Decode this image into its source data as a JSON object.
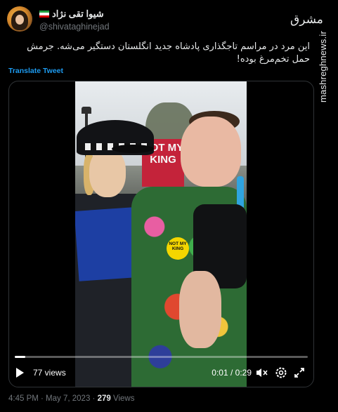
{
  "author": {
    "display_name": "شیوا تقی نژاد",
    "handle": "@shivataghinejad",
    "flag_colors": [
      "#239f40",
      "#ffffff",
      "#da0000"
    ]
  },
  "watermark": {
    "logo_text": "مشرق",
    "url_text": "mashreghnews.ir"
  },
  "tweet": {
    "text": "این مرد در مراسم تاجگذاری پادشاه جدید انگلستان دستگیر می‌شه. جرمش حمل تخم‌مرغ بوده!",
    "translate_label": "Translate Tweet"
  },
  "video": {
    "views_label": "77 views",
    "time_label": "0:01 / 0:29",
    "progress": 0.035,
    "sign_text": "NOT MY KING",
    "badge_text": "NOT MY KING"
  },
  "footer": {
    "timestamp": "4:45 PM · May 7, 2023",
    "separator": "·",
    "views_count": "279",
    "views_word": "Views"
  }
}
